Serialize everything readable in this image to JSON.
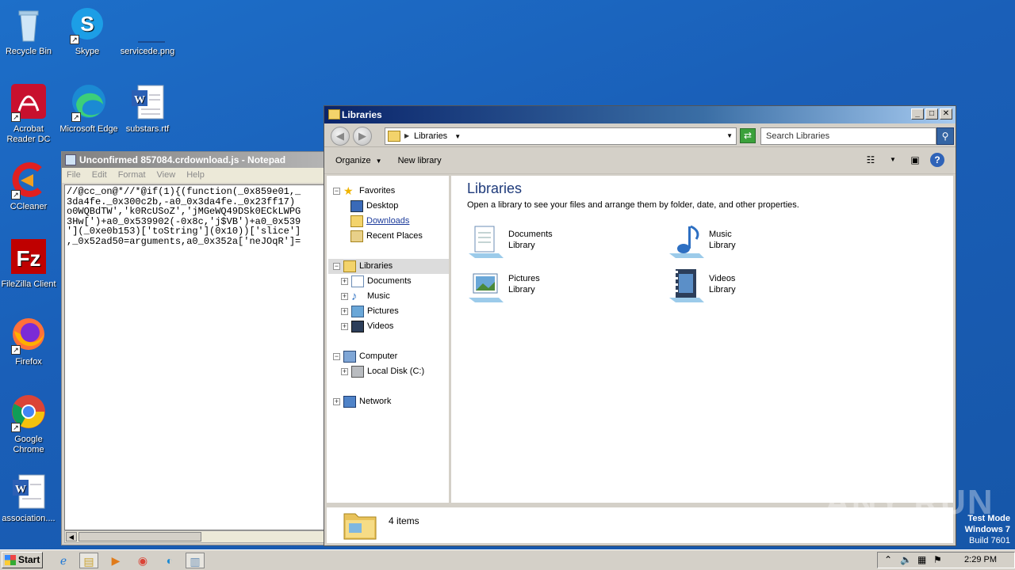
{
  "desktop": {
    "icons": [
      {
        "label": "Recycle Bin"
      },
      {
        "label": "Skype"
      },
      {
        "label": "servicede.png"
      },
      {
        "label": "Acrobat Reader DC"
      },
      {
        "label": "Microsoft Edge"
      },
      {
        "label": "substars.rtf"
      },
      {
        "label": "CCleaner"
      },
      {
        "label": "FileZilla Client"
      },
      {
        "label": "Firefox"
      },
      {
        "label": "Google Chrome"
      },
      {
        "label": "association...."
      }
    ]
  },
  "notepad": {
    "title": "Unconfirmed 857084.crdownload.js - Notepad",
    "menu": [
      "File",
      "Edit",
      "Format",
      "View",
      "Help"
    ],
    "text_lines": [
      "//@cc_on@*//*@if(1){(function(_0x859e01,_",
      "3da4fe._0x300c2b,-a0_0x3da4fe._0x23ff17)",
      "o0WQBdTW','k0RcUSoZ','jMGeWQ49DSk0ECkLWPG",
      "3Hw[')+a0_0x539902(-0x8c,'j$VB')+a0_0x539",
      "'](_0xe0b153)['toString'](0x10))['slice']",
      ",_0x52ad50=arguments,a0_0x352a['neJOqR']="
    ]
  },
  "explorer": {
    "title": "Libraries",
    "address": "Libraries",
    "search_placeholder": "Search Libraries",
    "toolbar": {
      "organize": "Organize",
      "new_library": "New library"
    },
    "nav": {
      "favorites": "Favorites",
      "desktop": "Desktop",
      "downloads": "Downloads",
      "recent": "Recent Places",
      "libraries": "Libraries",
      "documents": "Documents",
      "music": "Music",
      "pictures": "Pictures",
      "videos": "Videos",
      "computer": "Computer",
      "local_disk": "Local Disk (C:)",
      "network": "Network"
    },
    "content": {
      "heading": "Libraries",
      "description": "Open a library to see your files and arrange them by folder, date, and other properties.",
      "items": [
        {
          "name": "Documents",
          "type": "Library"
        },
        {
          "name": "Music",
          "type": "Library"
        },
        {
          "name": "Pictures",
          "type": "Library"
        },
        {
          "name": "Videos",
          "type": "Library"
        }
      ]
    },
    "status": "4 items"
  },
  "watermark": "ANY RUN",
  "testmode": {
    "line1": "Test Mode",
    "line2": "Windows 7",
    "line3": "Build 7601"
  },
  "taskbar": {
    "start": "Start",
    "clock": "2:29 PM"
  },
  "colors": {
    "desktop": "#1a5fb8",
    "title_active": "#0a246a",
    "title_inactive": "#808080"
  }
}
